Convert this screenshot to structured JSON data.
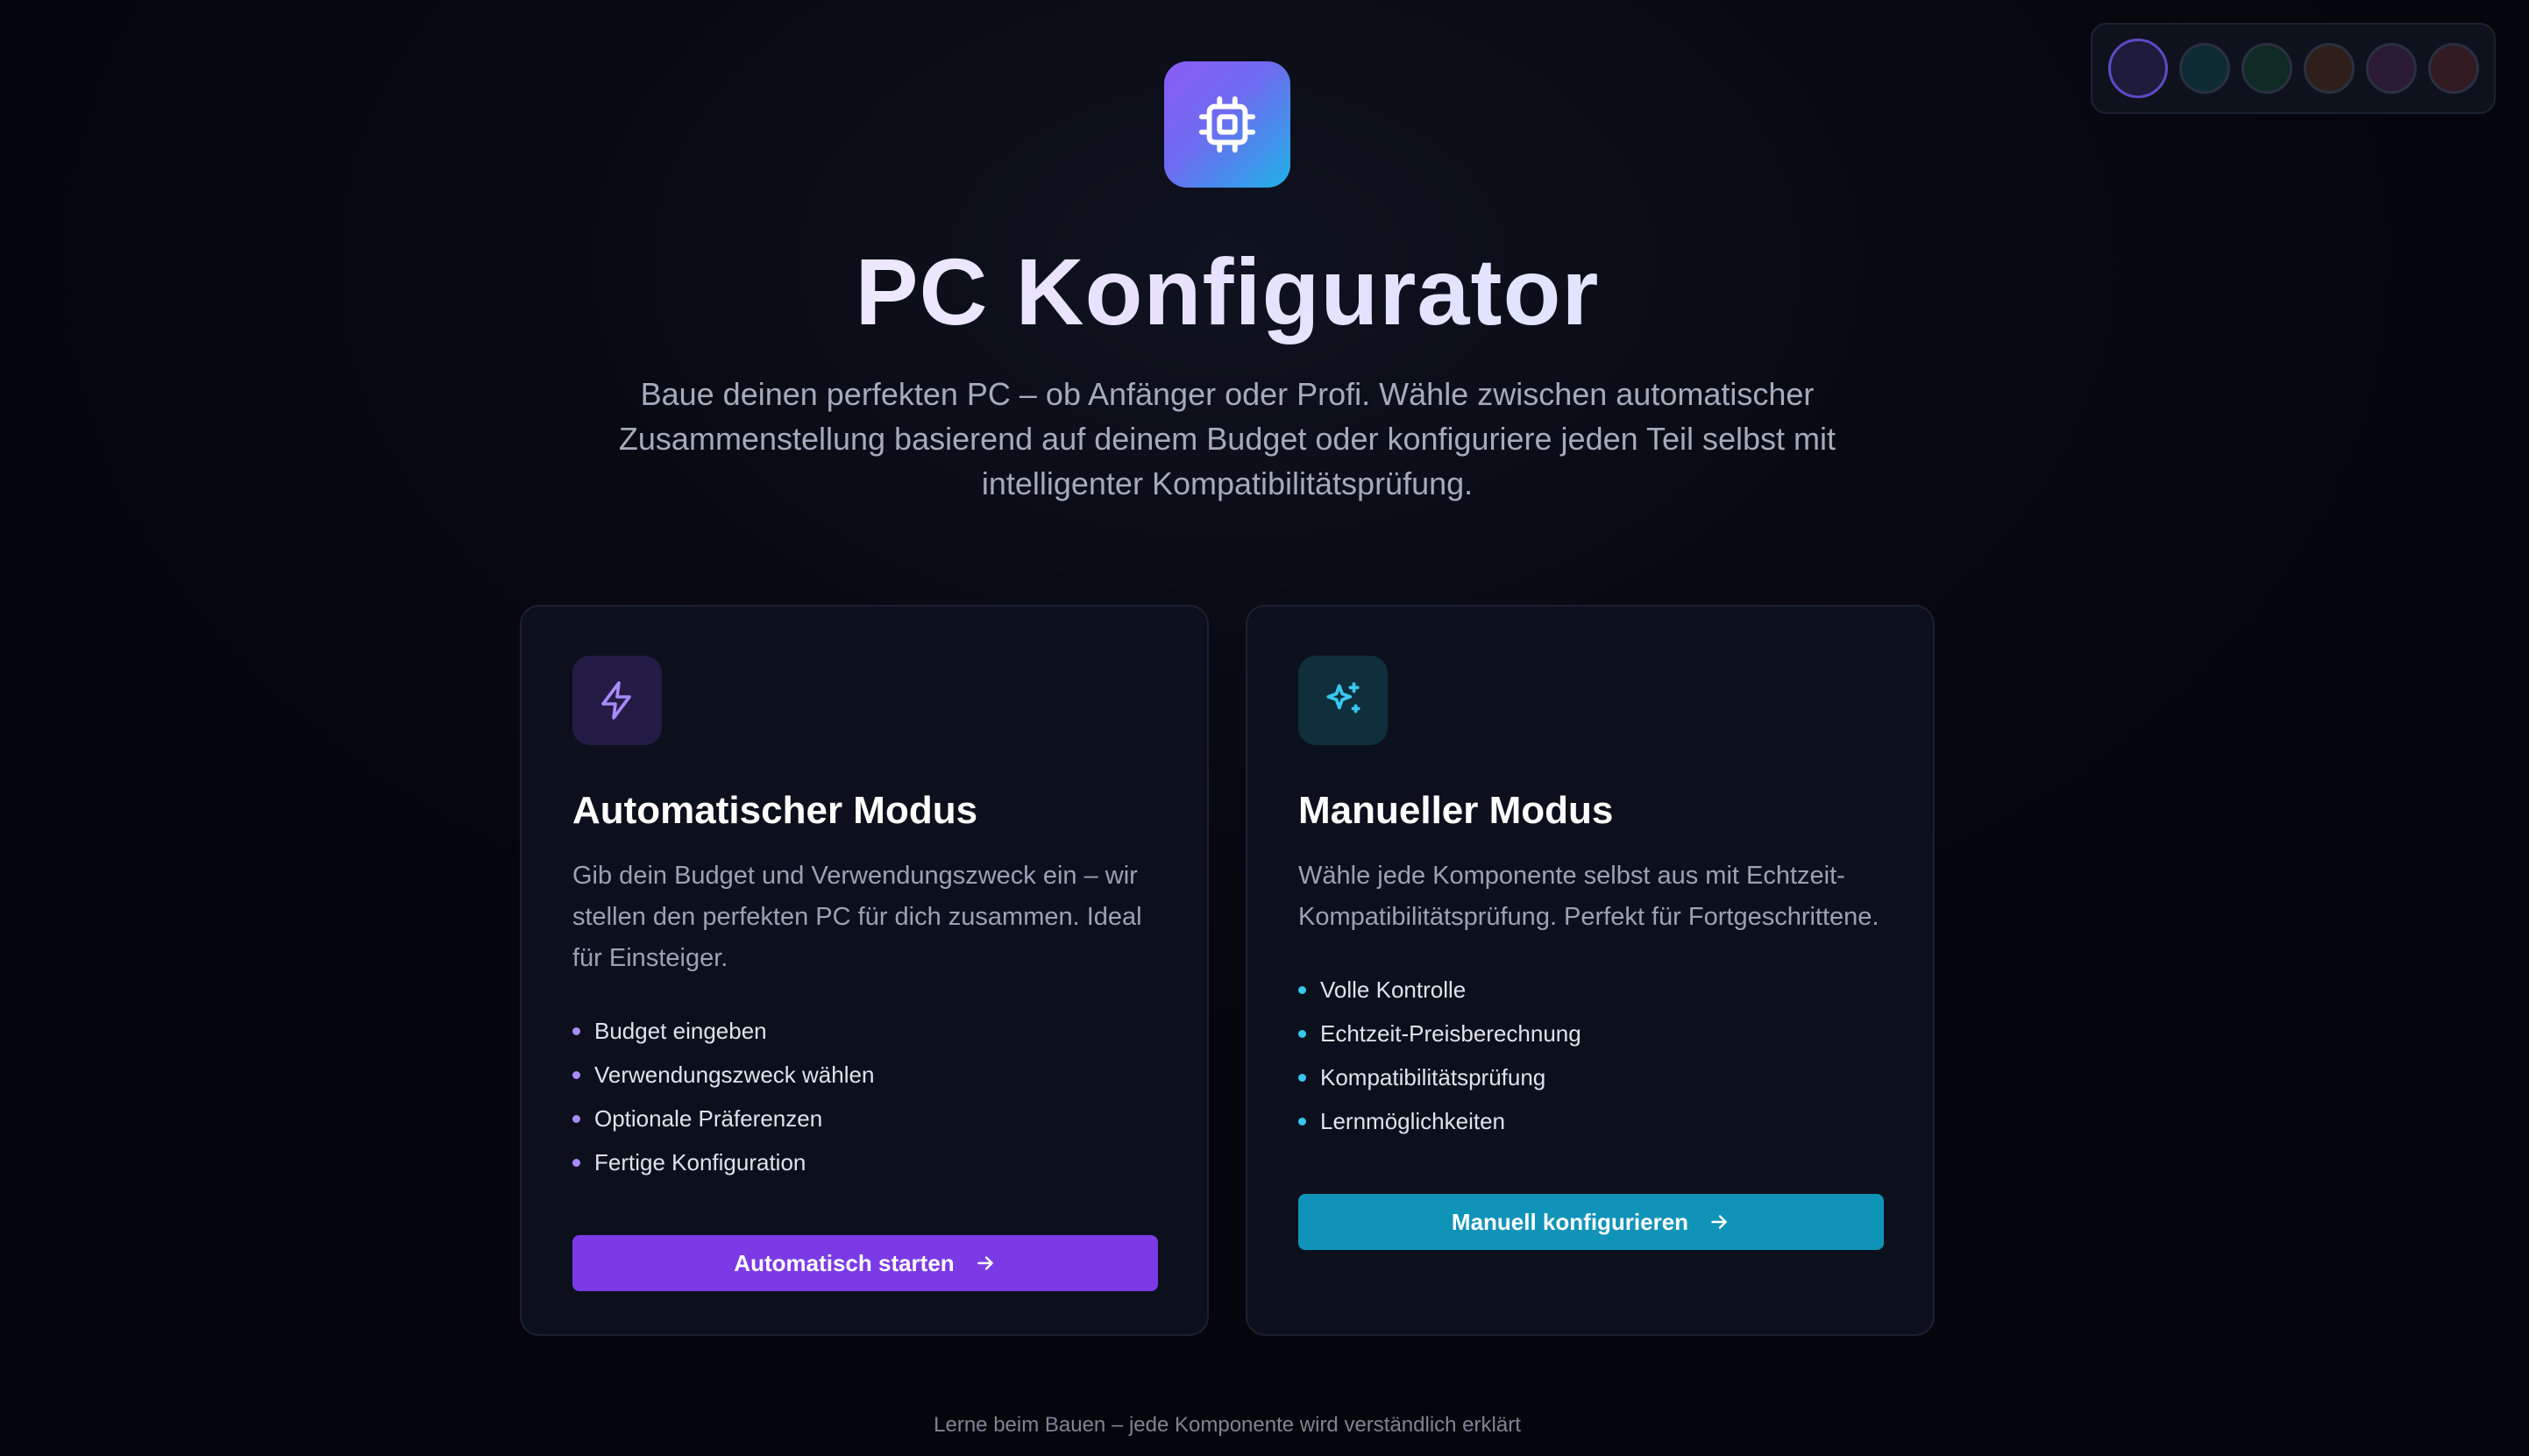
{
  "theme_picker": {
    "swatches": [
      "#1e1b3d",
      "#0f2b33",
      "#0f2a22",
      "#2e1f1a",
      "#2b1a33",
      "#311a22"
    ]
  },
  "header": {
    "logo_icon": "cpu-icon",
    "title": "PC Konfigurator",
    "subtitle": "Baue deinen perfekten PC – ob Anfänger oder Profi. Wähle zwischen automatischer Zusammenstellung basierend auf deinem Budget oder konfiguriere jeden Teil selbst mit intelligenter Kompatibilitätsprüfung."
  },
  "cards": {
    "auto": {
      "icon": "lightning-icon",
      "title": "Automatischer Modus",
      "description": "Gib dein Budget und Verwendungszweck ein – wir stellen den perfekten PC für dich zusammen. Ideal für Einsteiger.",
      "features": [
        "Budget eingeben",
        "Verwendungszweck wählen",
        "Optionale Präferenzen",
        "Fertige Konfiguration"
      ],
      "button_label": "Automatisch starten",
      "accent": "#7c3ae6"
    },
    "manual": {
      "icon": "sparkles-icon",
      "title": "Manueller Modus",
      "description": "Wähle jede Komponente selbst aus mit Echtzeit-Kompatibilitätsprüfung. Perfekt für Fortgeschrittene.",
      "features": [
        "Volle Kontrolle",
        "Echtzeit-Preisberechnung",
        "Kompatibilitätsprüfung",
        "Lernmöglichkeiten"
      ],
      "button_label": "Manuell konfigurieren",
      "accent": "#0f93b8"
    }
  },
  "footer": {
    "text": "Lerne beim Bauen – jede Komponente wird verständlich erklärt"
  }
}
